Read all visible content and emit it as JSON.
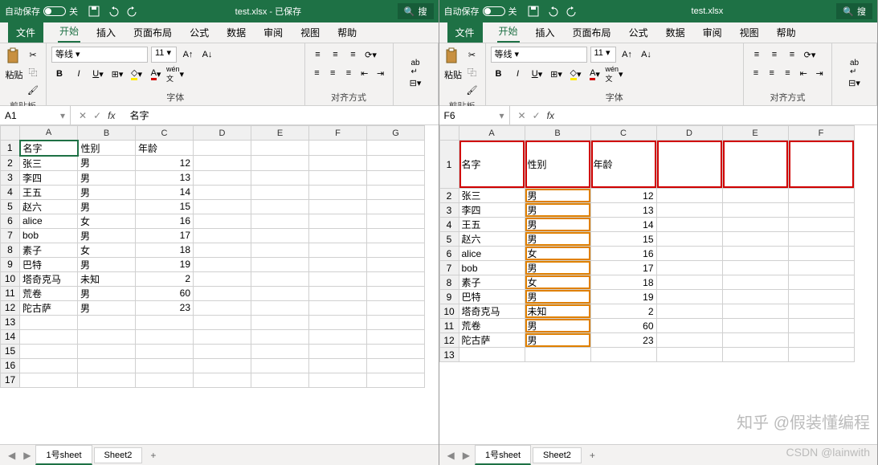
{
  "left": {
    "titlebar": {
      "autosave": "自动保存",
      "toggle_state": "关",
      "filename": "test.xlsx - 已保存",
      "search": "搜"
    },
    "menu": {
      "file": "文件",
      "home": "开始",
      "insert": "插入",
      "layout": "页面布局",
      "formula": "公式",
      "data": "数据",
      "review": "审阅",
      "view": "视图",
      "help": "帮助"
    },
    "ribbon": {
      "clipboard": "剪贴板",
      "paste": "粘贴",
      "font_label": "字体",
      "font_name": "等线",
      "font_size": "11",
      "align_label": "对齐方式"
    },
    "namebox": "A1",
    "formula": "名字",
    "cols": [
      "A",
      "B",
      "C",
      "D",
      "E",
      "F",
      "G"
    ],
    "rows": [
      {
        "r": "1",
        "v": [
          "名字",
          "性别",
          "年龄",
          "",
          "",
          "",
          ""
        ]
      },
      {
        "r": "2",
        "v": [
          "张三",
          "男",
          "12",
          "",
          "",
          "",
          ""
        ]
      },
      {
        "r": "3",
        "v": [
          "李四",
          "男",
          "13",
          "",
          "",
          "",
          ""
        ]
      },
      {
        "r": "4",
        "v": [
          "王五",
          "男",
          "14",
          "",
          "",
          "",
          ""
        ]
      },
      {
        "r": "5",
        "v": [
          "赵六",
          "男",
          "15",
          "",
          "",
          "",
          ""
        ]
      },
      {
        "r": "6",
        "v": [
          "alice",
          "女",
          "16",
          "",
          "",
          "",
          ""
        ]
      },
      {
        "r": "7",
        "v": [
          "bob",
          "男",
          "17",
          "",
          "",
          "",
          ""
        ]
      },
      {
        "r": "8",
        "v": [
          "素子",
          "女",
          "18",
          "",
          "",
          "",
          ""
        ]
      },
      {
        "r": "9",
        "v": [
          "巴特",
          "男",
          "19",
          "",
          "",
          "",
          ""
        ]
      },
      {
        "r": "10",
        "v": [
          "塔奇克马",
          "未知",
          "2",
          "",
          "",
          "",
          ""
        ]
      },
      {
        "r": "11",
        "v": [
          "荒卷",
          "男",
          "60",
          "",
          "",
          "",
          ""
        ]
      },
      {
        "r": "12",
        "v": [
          "陀古萨",
          "男",
          "23",
          "",
          "",
          "",
          ""
        ]
      },
      {
        "r": "13",
        "v": [
          "",
          "",
          "",
          "",
          "",
          "",
          ""
        ]
      },
      {
        "r": "14",
        "v": [
          "",
          "",
          "",
          "",
          "",
          "",
          ""
        ]
      },
      {
        "r": "15",
        "v": [
          "",
          "",
          "",
          "",
          "",
          "",
          ""
        ]
      },
      {
        "r": "16",
        "v": [
          "",
          "",
          "",
          "",
          "",
          "",
          ""
        ]
      },
      {
        "r": "17",
        "v": [
          "",
          "",
          "",
          "",
          "",
          "",
          ""
        ]
      }
    ],
    "sheets": {
      "s1": "1号sheet",
      "s2": "Sheet2",
      "add": "+"
    }
  },
  "right": {
    "titlebar": {
      "autosave": "自动保存",
      "toggle_state": "关",
      "filename": "test.xlsx",
      "search": "搜"
    },
    "menu": {
      "file": "文件",
      "home": "开始",
      "insert": "插入",
      "layout": "页面布局",
      "formula": "公式",
      "data": "数据",
      "review": "审阅",
      "view": "视图",
      "help": "帮助"
    },
    "ribbon": {
      "clipboard": "剪贴板",
      "paste": "粘贴",
      "font_label": "字体",
      "font_name": "等线",
      "font_size": "11",
      "align_label": "对齐方式"
    },
    "namebox": "F6",
    "formula": "",
    "cols": [
      "A",
      "B",
      "C",
      "D",
      "E",
      "F"
    ],
    "rows": [
      {
        "r": "1",
        "head": true,
        "v": [
          "名字",
          "性别",
          "年龄",
          "",
          "",
          ""
        ]
      },
      {
        "r": "2",
        "v": [
          "张三",
          "男",
          "12",
          "",
          "",
          ""
        ]
      },
      {
        "r": "3",
        "v": [
          "李四",
          "男",
          "13",
          "",
          "",
          ""
        ]
      },
      {
        "r": "4",
        "v": [
          "王五",
          "男",
          "14",
          "",
          "",
          ""
        ]
      },
      {
        "r": "5",
        "v": [
          "赵六",
          "男",
          "15",
          "",
          "",
          ""
        ]
      },
      {
        "r": "6",
        "v": [
          "alice",
          "女",
          "16",
          "",
          "",
          ""
        ]
      },
      {
        "r": "7",
        "v": [
          "bob",
          "男",
          "17",
          "",
          "",
          ""
        ]
      },
      {
        "r": "8",
        "v": [
          "素子",
          "女",
          "18",
          "",
          "",
          ""
        ]
      },
      {
        "r": "9",
        "v": [
          "巴特",
          "男",
          "19",
          "",
          "",
          ""
        ]
      },
      {
        "r": "10",
        "v": [
          "塔奇克马",
          "未知",
          "2",
          "",
          "",
          ""
        ]
      },
      {
        "r": "11",
        "v": [
          "荒卷",
          "男",
          "60",
          "",
          "",
          ""
        ]
      },
      {
        "r": "12",
        "v": [
          "陀古萨",
          "男",
          "23",
          "",
          "",
          ""
        ]
      },
      {
        "r": "13",
        "v": [
          "",
          "",
          "",
          "",
          "",
          ""
        ]
      }
    ],
    "sheets": {
      "s1": "1号sheet",
      "s2": "Sheet2",
      "add": "+"
    }
  },
  "watermark1": "知乎 @假装懂编程",
  "watermark2": "CSDN @lainwith"
}
